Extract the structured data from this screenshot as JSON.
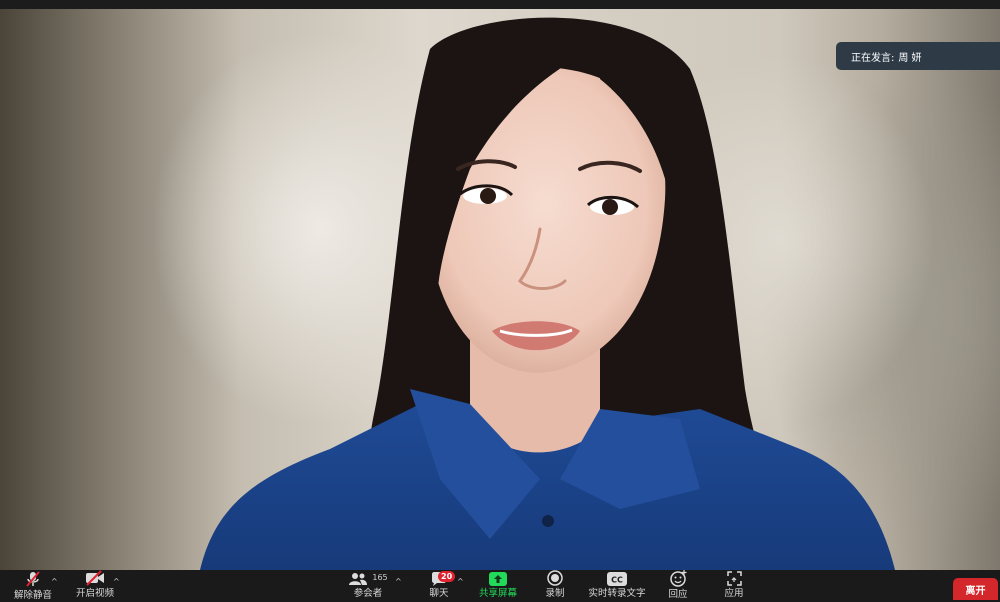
{
  "speaker_indicator": {
    "prefix": "正在发言:",
    "name": "周 妍"
  },
  "toolbar": {
    "mute": {
      "label": "解除静音",
      "icon": "mic-muted-icon"
    },
    "video": {
      "label": "开启视频",
      "icon": "video-off-icon"
    },
    "participants": {
      "label": "参会者",
      "count": "165",
      "icon": "participants-icon"
    },
    "chat": {
      "label": "聊天",
      "badge": "20",
      "icon": "chat-icon"
    },
    "share": {
      "label": "共享屏幕",
      "icon": "share-screen-icon",
      "color": "#23d959"
    },
    "record": {
      "label": "录制",
      "icon": "record-icon"
    },
    "captions": {
      "label": "实时转录文字",
      "icon": "cc-icon"
    },
    "reactions": {
      "label": "回应",
      "icon": "reaction-icon"
    },
    "apps": {
      "label": "应用",
      "icon": "apps-icon"
    },
    "leave": {
      "label": "离开",
      "color": "#d4272b"
    }
  }
}
